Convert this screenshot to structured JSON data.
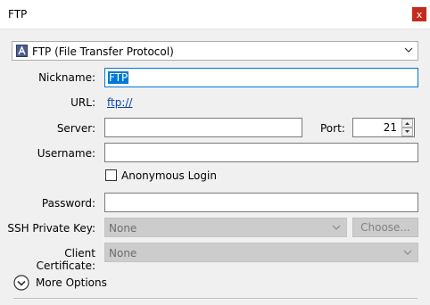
{
  "window": {
    "title": "FTP",
    "close_glyph": "x"
  },
  "protocol": {
    "selected": "FTP (File Transfer Protocol)"
  },
  "labels": {
    "nickname": "Nickname:",
    "url": "URL:",
    "server": "Server:",
    "port": "Port:",
    "username": "Username:",
    "password": "Password:",
    "ssh_key": "SSH Private Key:",
    "client_cert": "Client Certificate:"
  },
  "fields": {
    "nickname": "FTP",
    "url": "ftp://",
    "server": "",
    "port": "21",
    "username": "",
    "password": ""
  },
  "anonymous_login": {
    "label": "Anonymous Login",
    "checked": false
  },
  "ssh_key": {
    "selected": "None",
    "choose_label": "Choose..."
  },
  "client_cert": {
    "selected": "None"
  },
  "more_options": {
    "label": "More Options"
  },
  "colors": {
    "accent": "#0078d7",
    "close": "#c42b1c",
    "link": "#0645ad"
  },
  "icons": [
    "protocol-icon",
    "chevron-down-icon",
    "close-icon",
    "expand-icon"
  ]
}
